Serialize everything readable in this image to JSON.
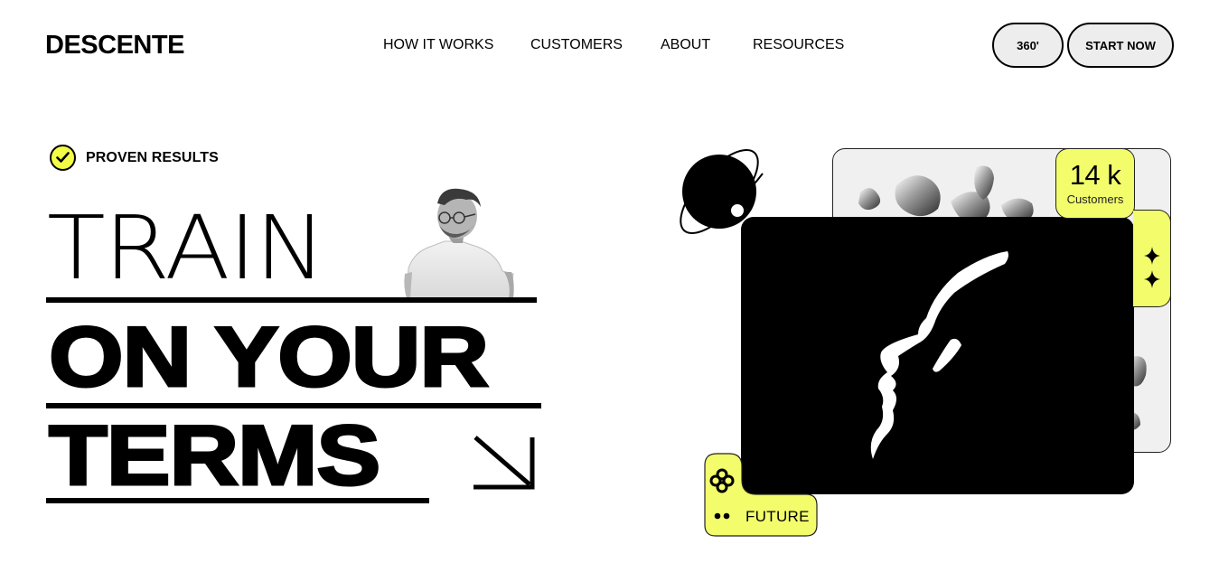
{
  "header": {
    "logo": "DESCENTE",
    "nav": [
      {
        "label": "HOW IT WORKS"
      },
      {
        "label": "CUSTOMERS"
      },
      {
        "label": "ABOUT"
      },
      {
        "label": "RESOURCES"
      }
    ],
    "btn_360": "360'",
    "btn_start": "START NOW"
  },
  "hero": {
    "badge": "PROVEN RESULTS",
    "line1": "TRAIN",
    "line2": "ON YOUR",
    "line3": "TERMS"
  },
  "visual": {
    "stat_value": "14 k",
    "stat_label": "Customers",
    "future_label": "FUTURE"
  },
  "colors": {
    "accent": "#f3fd6b",
    "ink": "#000000",
    "button_bg": "#ededed"
  },
  "icons": [
    "check-icon",
    "arrow-down-right-icon",
    "planet-icon",
    "sparkle-icon",
    "knot-icon",
    "dots-icon"
  ]
}
